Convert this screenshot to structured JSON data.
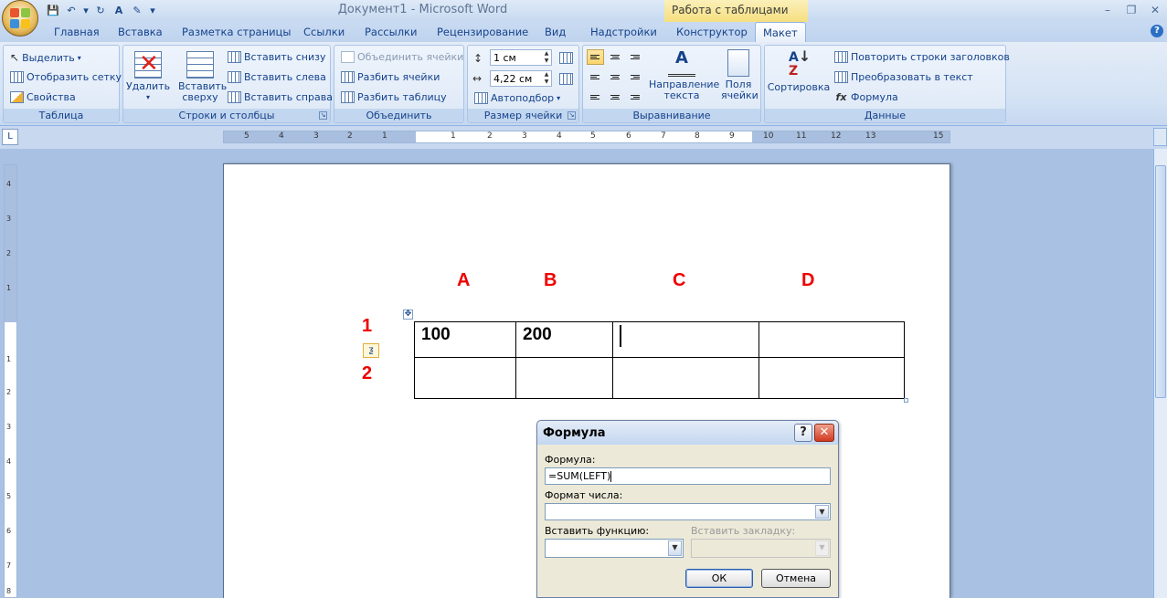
{
  "window": {
    "title": "Документ1 - Microsoft Word",
    "context_group": "Работа с таблицами",
    "controls": [
      "–",
      "❐",
      "✕"
    ]
  },
  "qat": {
    "save": "💾",
    "undo": "↶",
    "undo_drop": "▾",
    "redo": "↻",
    "spell": "А",
    "format": "✎",
    "more": "▾"
  },
  "tabs": [
    {
      "label": "Главная"
    },
    {
      "label": "Вставка"
    },
    {
      "label": "Разметка страницы"
    },
    {
      "label": "Ссылки"
    },
    {
      "label": "Рассылки"
    },
    {
      "label": "Рецензирование"
    },
    {
      "label": "Вид"
    },
    {
      "label": "Надстройки"
    },
    {
      "label": "Конструктор"
    },
    {
      "label": "Макет"
    }
  ],
  "help": "?",
  "ribbon": {
    "table": {
      "label": "Таблица",
      "select": "Выделить",
      "select_arrow": "▾",
      "show_grid": "Отобразить сетку",
      "properties": "Свойства"
    },
    "rows_cols": {
      "label": "Строки и столбцы",
      "delete": "Удалить",
      "delete_arrow": "▾",
      "insert_above": "Вставить сверху",
      "insert_below": "Вставить снизу",
      "insert_left": "Вставить слева",
      "insert_right": "Вставить справа"
    },
    "merge": {
      "label": "Объединить",
      "merge_cells": "Объединить ячейки",
      "split_cells": "Разбить ячейки",
      "split_table": "Разбить таблицу"
    },
    "cell_size": {
      "label": "Размер ячейки",
      "height": "1 см",
      "width": "4,22 см",
      "autofit": "Автоподбор",
      "autofit_arrow": "▾"
    },
    "alignment": {
      "label": "Выравнивание",
      "text_direction": "Направление текста",
      "cell_margins": "Поля ячейки"
    },
    "data": {
      "label": "Данные",
      "sort": "Сортировка",
      "repeat_headers": "Повторить строки заголовков",
      "convert": "Преобразовать в текст",
      "formula": "Формула"
    }
  },
  "ruler": {
    "corner": "L",
    "h_numbers": [
      "5",
      "4",
      "3",
      "2",
      "1",
      "1",
      "2",
      "3",
      "4",
      "5",
      "6",
      "7",
      "8",
      "9",
      "10",
      "11",
      "12",
      "13",
      "15"
    ],
    "v_numbers": [
      "4",
      "3",
      "2",
      "1",
      "1",
      "2",
      "3",
      "4",
      "5",
      "6",
      "7",
      "8"
    ]
  },
  "document": {
    "col_labels": [
      "A",
      "B",
      "C",
      "D"
    ],
    "row_labels": [
      "1",
      "2"
    ],
    "table": [
      [
        "100",
        "200",
        "",
        ""
      ],
      [
        "",
        "",
        "",
        ""
      ]
    ],
    "move_handle": "✥",
    "smart_tag": "ƺ"
  },
  "dialog": {
    "title": "Формула",
    "help": "?",
    "close": "✕",
    "formula_label": "Формула:",
    "formula_value": "=SUM(LEFT)",
    "number_format_label": "Формат числа:",
    "number_format_value": "",
    "insert_function_label": "Вставить функцию:",
    "insert_function_value": "",
    "insert_bookmark_label": "Вставить закладку:",
    "insert_bookmark_value": "",
    "dropdown_arrow": "▼",
    "ok": "ОК",
    "cancel": "Отмена"
  }
}
